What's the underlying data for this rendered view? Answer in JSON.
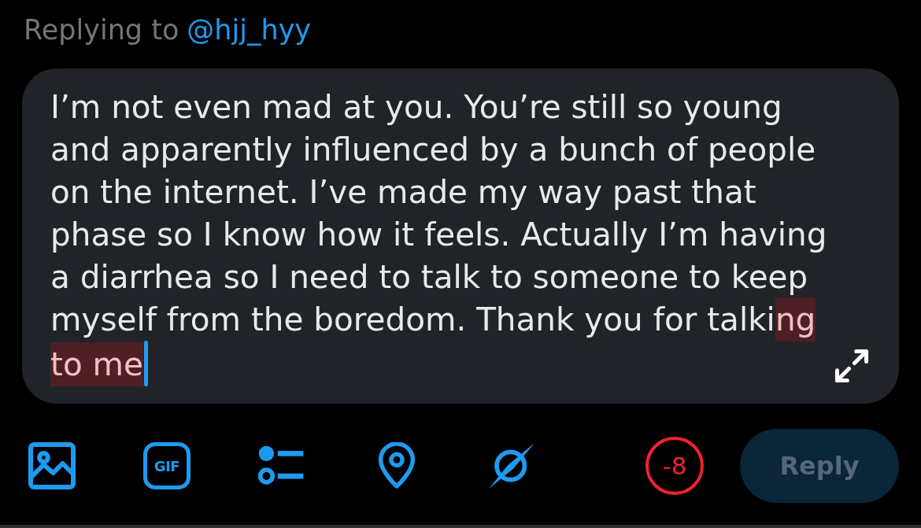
{
  "reply_context": {
    "label": "Replying to",
    "handle": "@hjj_hyy"
  },
  "composer": {
    "text": "I’m not even mad at you. You’re still so young and apparently influenced by a bunch of people on the internet. I’ve made my way past that phase so I know how it feels. Actually I’m having a diarrhea so I need to talk to someone to keep myself from the boredom. Thank you for talki",
    "overflow_text": "ng to me"
  },
  "tools": [
    {
      "kind": "image"
    },
    {
      "kind": "gif",
      "label": "GIF"
    },
    {
      "kind": "poll"
    },
    {
      "kind": "location"
    },
    {
      "kind": "circle"
    }
  ],
  "counter": {
    "text": "-8",
    "over_limit": true
  },
  "reply_button": {
    "label": "Reply",
    "disabled": true
  }
}
